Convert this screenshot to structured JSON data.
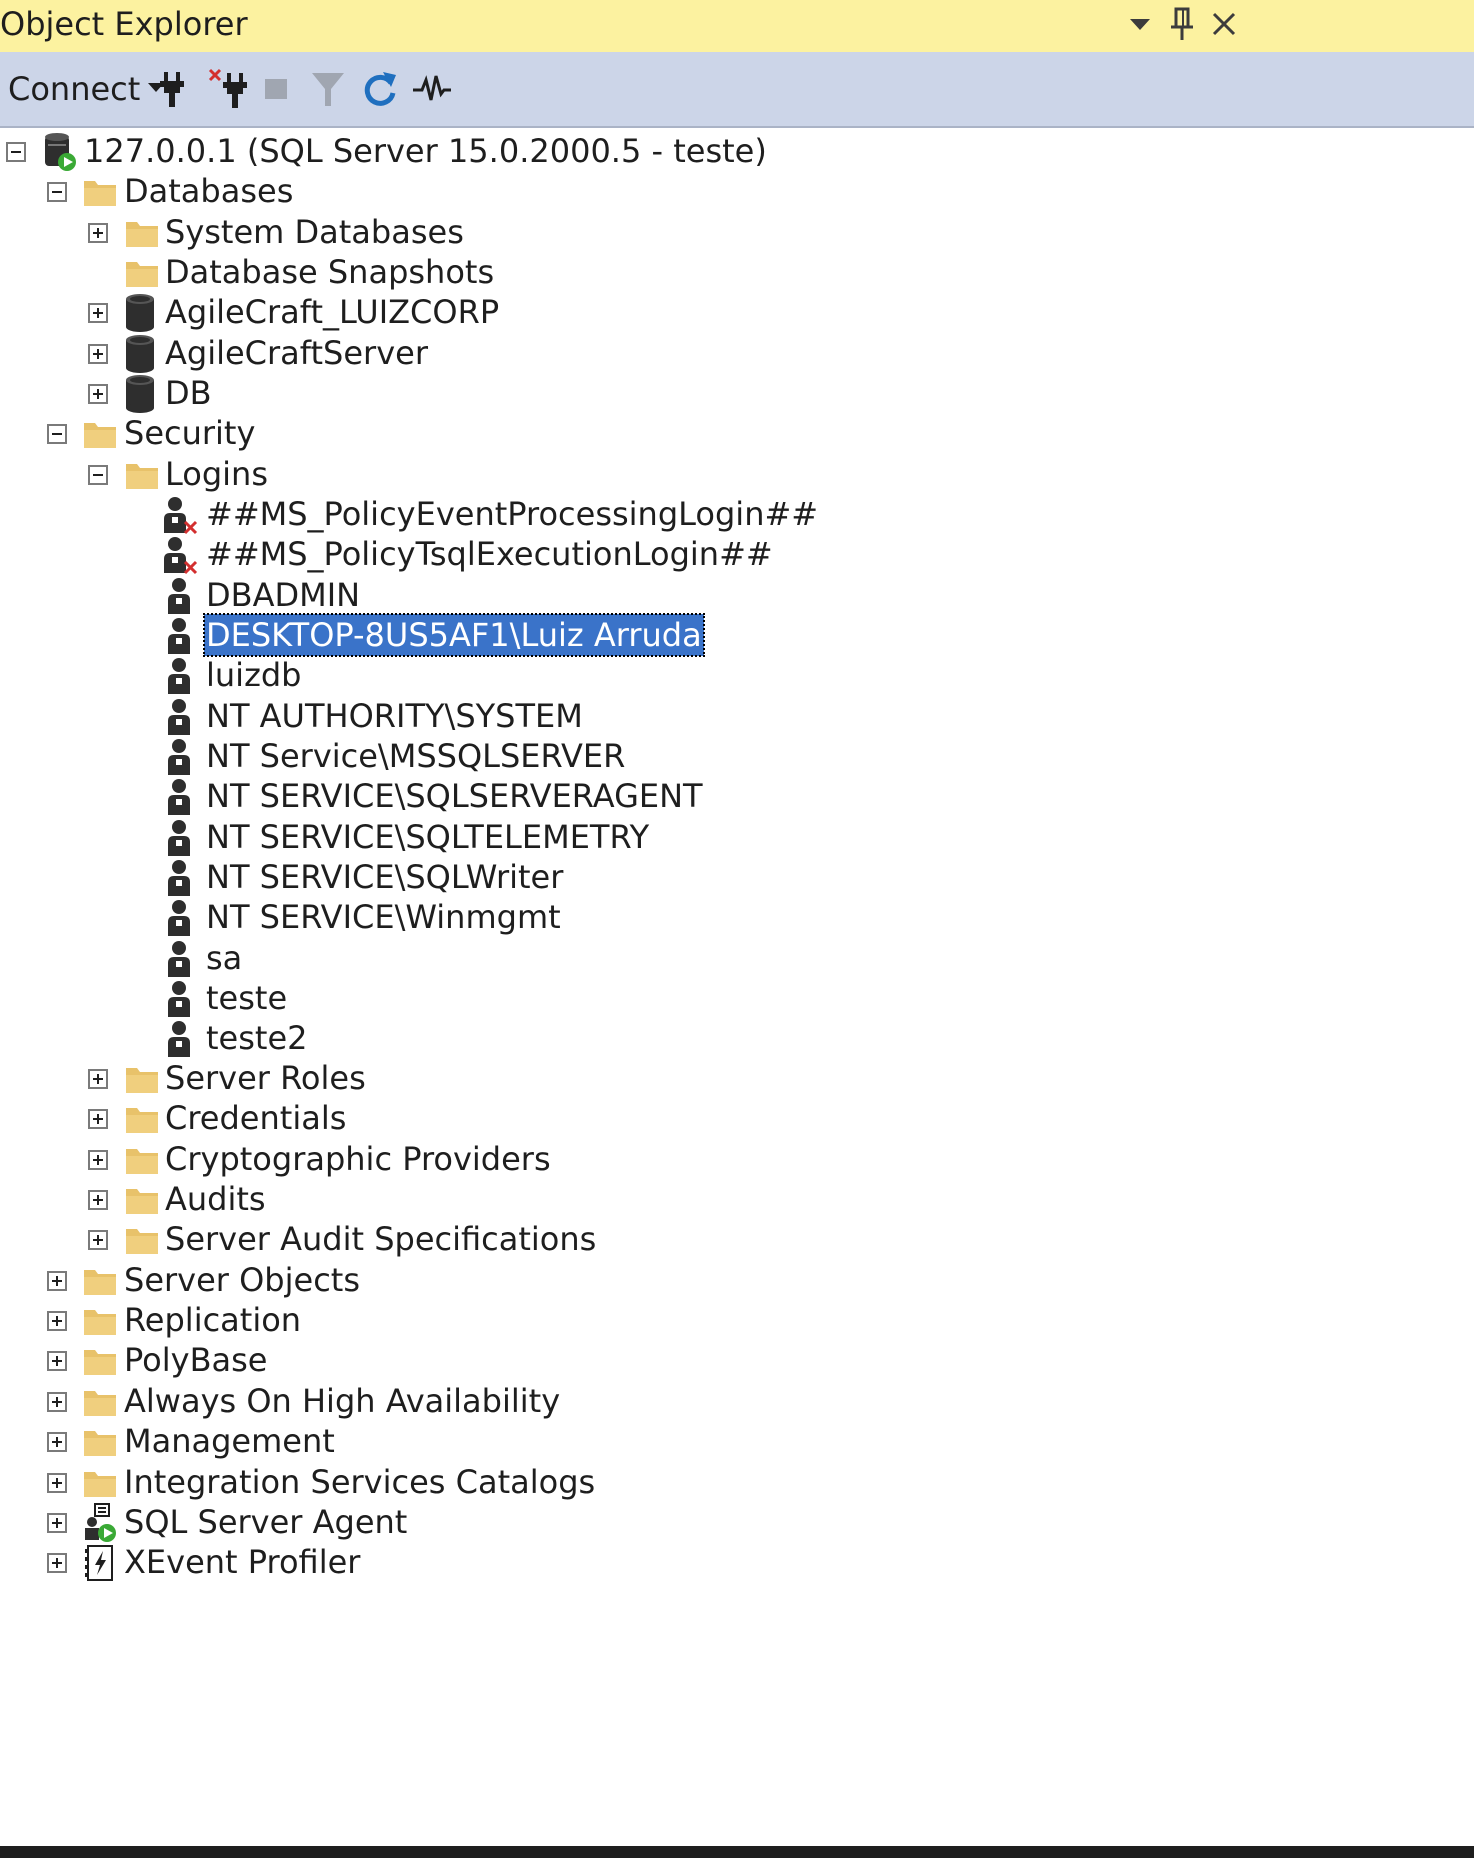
{
  "window": {
    "title": "Object Explorer",
    "buttons": [
      "window-position-dropdown",
      "auto-hide-pin",
      "close"
    ]
  },
  "toolbar": {
    "connect_label": "Connect",
    "tools": [
      "connect-object-explorer",
      "disconnect",
      "stop",
      "filter",
      "refresh",
      "activity-monitor"
    ]
  },
  "tree": {
    "server": {
      "label": "127.0.0.1 (SQL Server 15.0.2000.5 - teste)",
      "expanded": true
    },
    "databases": {
      "label": "Databases",
      "children": [
        {
          "label": "System Databases",
          "expander": "plus",
          "icon": "folder"
        },
        {
          "label": "Database Snapshots",
          "expander": "none",
          "icon": "folder"
        },
        {
          "label": "AgileCraft_LUIZCORP",
          "expander": "plus",
          "icon": "database"
        },
        {
          "label": "AgileCraftServer",
          "expander": "plus",
          "icon": "database"
        },
        {
          "label": "DB",
          "expander": "plus",
          "icon": "database"
        }
      ]
    },
    "security": {
      "label": "Security",
      "logins": {
        "label": "Logins",
        "items": [
          {
            "label": "##MS_PolicyEventProcessingLogin##",
            "disabled": true
          },
          {
            "label": "##MS_PolicyTsqlExecutionLogin##",
            "disabled": true
          },
          {
            "label": "DBADMIN",
            "disabled": false
          },
          {
            "label": "DESKTOP-8US5AF1\\Luiz Arruda",
            "disabled": false,
            "selected": true
          },
          {
            "label": "luizdb",
            "disabled": false
          },
          {
            "label": "NT AUTHORITY\\SYSTEM",
            "disabled": false
          },
          {
            "label": "NT Service\\MSSQLSERVER",
            "disabled": false
          },
          {
            "label": "NT SERVICE\\SQLSERVERAGENT",
            "disabled": false
          },
          {
            "label": "NT SERVICE\\SQLTELEMETRY",
            "disabled": false
          },
          {
            "label": "NT SERVICE\\SQLWriter",
            "disabled": false
          },
          {
            "label": "NT SERVICE\\Winmgmt",
            "disabled": false
          },
          {
            "label": "sa",
            "disabled": false
          },
          {
            "label": "teste",
            "disabled": false
          },
          {
            "label": "teste2",
            "disabled": false
          }
        ]
      },
      "children_after": [
        "Server Roles",
        "Credentials",
        "Cryptographic Providers",
        "Audits",
        "Server Audit Specifications"
      ]
    },
    "top_level_after": [
      {
        "label": "Server Objects",
        "icon": "folder"
      },
      {
        "label": "Replication",
        "icon": "folder"
      },
      {
        "label": "PolyBase",
        "icon": "folder"
      },
      {
        "label": "Always On High Availability",
        "icon": "folder"
      },
      {
        "label": "Management",
        "icon": "folder"
      },
      {
        "label": "Integration Services Catalogs",
        "icon": "folder"
      },
      {
        "label": "SQL Server Agent",
        "icon": "sql-agent"
      },
      {
        "label": "XEvent Profiler",
        "icon": "xevent"
      }
    ]
  },
  "colors": {
    "titlebar_bg": "#fcf2a0",
    "toolbar_bg": "#ccd5e8",
    "selection_bg": "#3a73c9",
    "folder": "#e8c26a",
    "refresh_blue": "#1f6fbf",
    "status_green": "#3aa935",
    "disabled_red": "#d32f2f"
  }
}
